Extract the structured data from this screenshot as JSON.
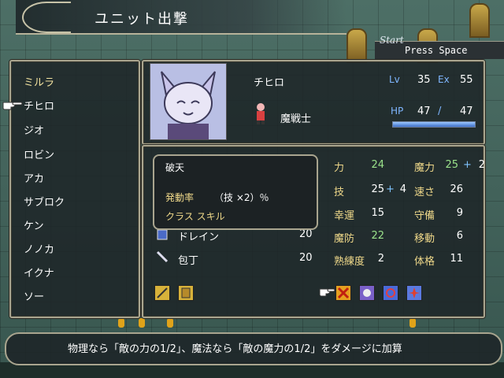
{
  "screen_title": "ユニット出撃",
  "start_label": "Start",
  "press_label": "Press Space",
  "units": [
    "ミルラ",
    "チヒロ",
    "ジオ",
    "ロビン",
    "アカ",
    "サブロク",
    "ケン",
    "ノノカ",
    "イクナ",
    "ソー"
  ],
  "selected_unit": {
    "name": "チヒロ",
    "class": "魔戦士",
    "lv_label": "Lv",
    "lv": "35",
    "ex_label": "Ex",
    "ex": "55",
    "hp_label": "HP",
    "hp": "47",
    "hp_slash": "/",
    "hp_max": "47",
    "hp_fraction": 1.0
  },
  "stats": {
    "str_label": "力",
    "str": "24",
    "mag_label": "魔力",
    "mag": "25",
    "mag_plus": "+",
    "mag_bonus": "2",
    "skl_label": "技",
    "skl": "25",
    "skl_plus": "+",
    "skl_bonus": "4",
    "spd_label": "速さ",
    "spd": "26",
    "lck_label": "幸運",
    "lck": "15",
    "def_label": "守備",
    "def": "9",
    "res_label": "魔防",
    "res": "22",
    "mov_label": "移動",
    "mov": "6",
    "prof_label": "熟練度",
    "prof": "2",
    "con_label": "体格",
    "con": "11"
  },
  "items": [
    {
      "name": "ドレイン",
      "uses": "20"
    },
    {
      "name": "包丁",
      "uses": "20"
    }
  ],
  "skill_popup": {
    "name": "破天",
    "rate_label": "発動率",
    "rate_value": "（技 ×2）％",
    "class_label": "クラス スキル"
  },
  "help_text": "物理なら「敵の力の1/2」、魔法なら「敵の魔力の1/2」をダメージに加算",
  "colors": {
    "label": "#f0d98a",
    "accent_blue": "#7fb6ff",
    "green": "#9be38b"
  }
}
